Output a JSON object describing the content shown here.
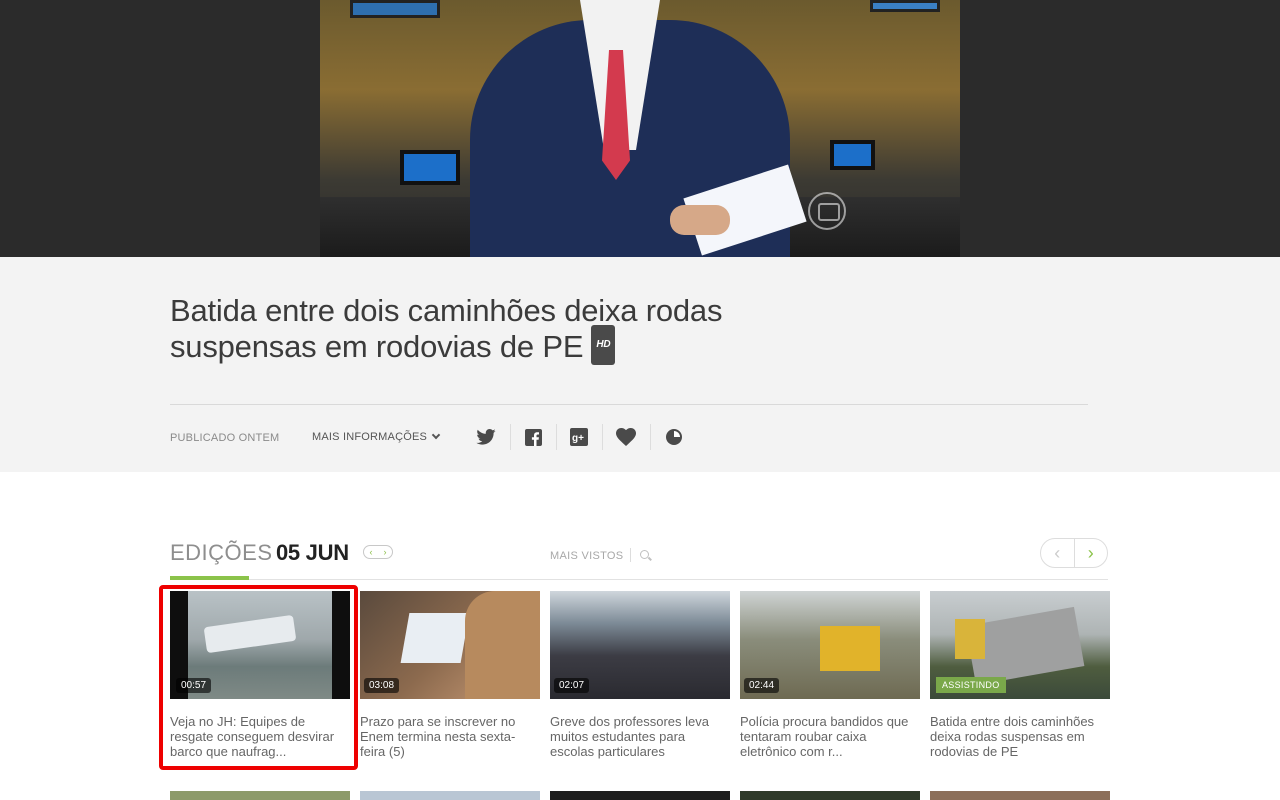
{
  "video": {
    "title": "Batida entre dois caminhões deixa rodas suspensas em rodovias de PE",
    "hd_badge": "HD",
    "published": "PUBLICADO ONTEM",
    "more_info": "MAIS INFORMAÇÕES",
    "social": [
      "twitter-icon",
      "facebook-icon",
      "google-plus-icon",
      "heart-icon",
      "clock-icon"
    ]
  },
  "editions": {
    "label": "EDIÇÕES",
    "date": "05 JUN",
    "pager_prev": "‹",
    "pager_next": "›",
    "most_viewed": "MAIS VISTOS",
    "nav_prev": "‹",
    "nav_next": "›"
  },
  "cards": [
    {
      "duration": "00:57",
      "title": "Veja no JH: Equipes de resgate conseguem desvirar barco que naufrag..."
    },
    {
      "duration": "03:08",
      "title": "Prazo para se inscrever no Enem termina nesta sexta-feira (5)"
    },
    {
      "duration": "02:07",
      "title": "Greve dos professores leva muitos estudantes para escolas particulares"
    },
    {
      "duration": "02:44",
      "title": "Polícia procura bandidos que tentaram roubar caixa eletrônico com r..."
    },
    {
      "badge": "ASSISTINDO",
      "title": "Batida entre dois caminhões deixa rodas suspensas em rodovias de PE"
    }
  ],
  "colors": {
    "accent": "#8bc34a",
    "highlight": "#e00000",
    "info_bg": "#f3f3f3",
    "player_bg": "#2b2b2b"
  }
}
